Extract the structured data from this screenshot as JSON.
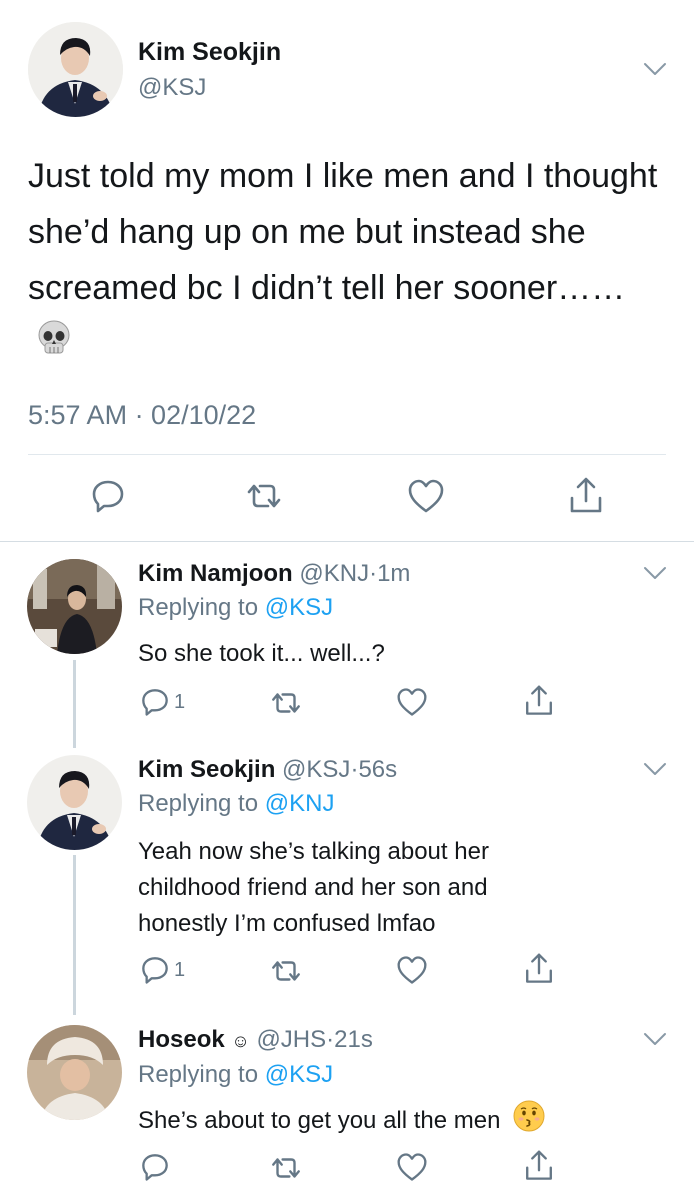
{
  "main_tweet": {
    "display_name": "Kim Seokjin",
    "handle": "@KSJ",
    "text": "Just told my mom I like men and I thought she’d hang up on me but instead she screamed bc I didn’t tell her sooner……",
    "emoji": "skull",
    "timestamp": "5:57 AM · 02/10/22"
  },
  "replies": [
    {
      "display_name": "Kim Namjoon",
      "handle": "@KNJ",
      "age": "1m",
      "replying_label": "Replying to",
      "replying_to": "@KSJ",
      "text": "So she took it... well...?",
      "reply_count": "1"
    },
    {
      "display_name": "Kim Seokjin",
      "handle": "@KSJ",
      "age": "56s",
      "replying_label": "Replying to",
      "replying_to": "@KNJ",
      "text_lines": [
        "Yeah now she’s talking about her",
        "childhood friend and her son and",
        "honestly I’m confused lmfao"
      ],
      "reply_count": "1"
    },
    {
      "display_name": "Hoseok",
      "name_symbol": "☺",
      "handle": "@JHS",
      "age": "21s",
      "replying_label": "Replying to",
      "replying_to": "@KSJ",
      "text": "She’s about to get you all the men",
      "emoji": "kissing-face",
      "reply_count": ""
    }
  ],
  "separator": "·",
  "colors": {
    "link": "#1da1f2",
    "secondary": "#657786",
    "icon": "#657786",
    "divider": "#e1e8ed"
  }
}
